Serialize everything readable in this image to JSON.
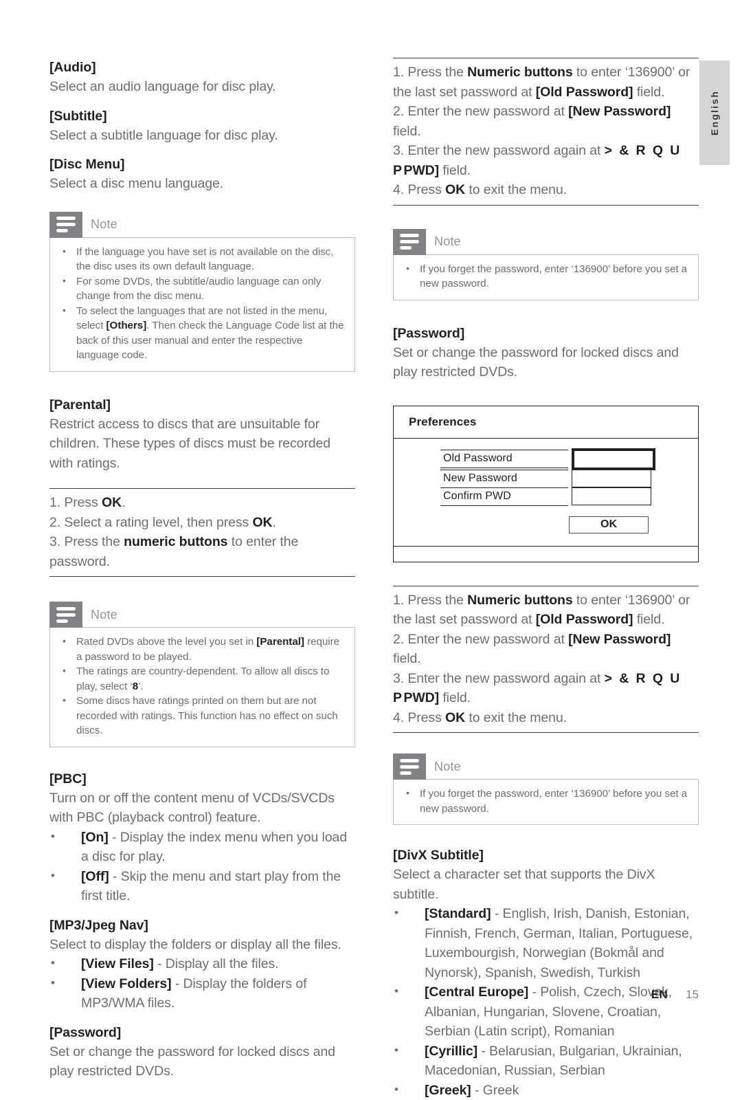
{
  "side_tab": {
    "language": "English"
  },
  "footer": {
    "locale": "EN",
    "page_number": "15"
  },
  "left_column": {
    "audio": {
      "title": "[Audio]",
      "body": "Select an audio language for disc play."
    },
    "subtitle": {
      "title": "[Subtitle]",
      "body": "Select a subtitle language for disc play."
    },
    "disc_menu": {
      "title": "[Disc Menu]",
      "body": "Select a disc menu language."
    },
    "note_language": {
      "label": "Note",
      "icon": "note-lines-icon",
      "bullets": [
        "If the language you have set is not available on the disc, the disc uses its own default language.",
        "For some DVDs, the subtitle/audio language can only change from the disc menu.",
        "To select the languages that are not listed in the menu, select [Others]. Then check the Language Code list at the back of this user manual and enter the respective language code."
      ],
      "bullet3_part1": "To select the languages that are not listed in the menu, select ",
      "bullet3_bold": "[Others]",
      "bullet3_part2": ". Then check the Language Code list at the back of this user manual and enter the respective language code."
    },
    "parental": {
      "title": "[Parental]",
      "body": "Restrict access to discs that are unsuitable for children. These types of discs must be recorded with ratings.",
      "steps": [
        {
          "num": "1. Press ",
          "bold": "OK",
          "tail": "."
        },
        {
          "num": "2. Select a rating level, then press ",
          "bold": "OK",
          "tail": "."
        },
        {
          "num": "3. Press the ",
          "bold": "numeric buttons",
          "tail": " to enter the password."
        }
      ]
    },
    "note_parental": {
      "label": "Note",
      "icon": "note-lines-icon",
      "bullet1_part1": "Rated DVDs above the level you set in ",
      "bullet1_bold": "[Parental]",
      "bullet1_part2": " require a password to be played.",
      "bullet2_part1": "The ratings are country-dependent. To allow all discs to play, select ‘",
      "bullet2_bold": "8",
      "bullet2_part2": "’.",
      "bullet3": "Some discs have ratings printed on them but are not recorded with ratings. This function has no effect on such discs."
    },
    "pbc": {
      "title": "[PBC]",
      "body": "Turn on or off the content menu of VCDs/SVCDs with PBC (playback control) feature.",
      "options": [
        {
          "bold": "[On]",
          "text": " - Display the index menu when you load a disc for play."
        },
        {
          "bold": "[Off]",
          "text": " - Skip the menu and start play from the first title."
        }
      ]
    },
    "mp3_jpeg_nav": {
      "title": "[MP3/Jpeg Nav]",
      "body": "Select to display the folders or display all the files.",
      "options": [
        {
          "bold": "[View Files]",
          "text": " - Display all the files."
        },
        {
          "bold": "[View Folders]",
          "text": " - Display the folders of MP3/WMA files."
        }
      ]
    },
    "password": {
      "title": "[Password]",
      "body": "Set or change the password for locked discs and play restricted DVDs."
    }
  },
  "right_column": {
    "steps_top": {
      "s1_a": "1. Press the ",
      "s1_b": "Numeric buttons",
      "s1_c": " to enter ‘136900’ or the last set password at ",
      "s1_d": "[Old Password]",
      "s1_e": " field.",
      "s2_a": "2. Enter the new password at ",
      "s2_b": "[New Password]",
      "s2_c": " field.",
      "s3_a": "3. Enter the new password again at ",
      "s3_glitch": "> & R Q  U P",
      "s3_b": "PWD]",
      "s3_c": " field.",
      "s4_a": "4. Press ",
      "s4_b": "OK",
      "s4_c": " to exit the menu."
    },
    "note_forgot_top": {
      "label": "Note",
      "icon": "note-lines-icon",
      "bullet": "If you forget the password, enter ‘136900’ before you set a new password."
    },
    "password": {
      "title": "[Password]",
      "body": "Set or change the password for locked discs and play restricted DVDs."
    },
    "preferences_dialog": {
      "title": "Preferences",
      "fields": [
        {
          "label": "Old Password",
          "value": "",
          "focused": true
        },
        {
          "label": "New Password",
          "value": "",
          "focused": false
        },
        {
          "label": "Confirm PWD",
          "value": "",
          "focused": false
        }
      ],
      "ok_button": "OK"
    },
    "steps_bottom": {
      "s1_a": "1. Press the ",
      "s1_b": "Numeric buttons",
      "s1_c": " to enter ‘136900’ or the last set password at ",
      "s1_d": "[Old Password]",
      "s1_e": " field.",
      "s2_a": "2. Enter the new password at ",
      "s2_b": "[New Password]",
      "s2_c": " field.",
      "s3_a": "3. Enter the new password again at ",
      "s3_glitch": "> & R Q  U P",
      "s3_b": "PWD]",
      "s3_c": " field.",
      "s4_a": "4. Press ",
      "s4_b": "OK",
      "s4_c": " to exit the menu."
    },
    "note_forgot_bottom": {
      "label": "Note",
      "icon": "note-lines-icon",
      "bullet": "If you forget the password, enter ‘136900’ before you set a new password."
    },
    "divx_subtitle": {
      "title": "[DivX Subtitle]",
      "body": "Select a character set that supports the DivX subtitle.",
      "options": [
        {
          "bold": "[Standard]",
          "text": " - English, Irish, Danish, Estonian, Finnish, French, German, Italian, Portuguese, Luxembourgish, Norwegian (Bokmål and Nynorsk), Spanish, Swedish, Turkish"
        },
        {
          "bold": "[Central Europe]",
          "text": " - Polish, Czech, Slovak, Albanian, Hungarian, Slovene, Croatian, Serbian (Latin script), Romanian"
        },
        {
          "bold": "[Cyrillic]",
          "text": " - Belarusian, Bulgarian, Ukrainian, Macedonian, Russian, Serbian"
        },
        {
          "bold": "[Greek]",
          "text": " - Greek"
        }
      ]
    }
  }
}
